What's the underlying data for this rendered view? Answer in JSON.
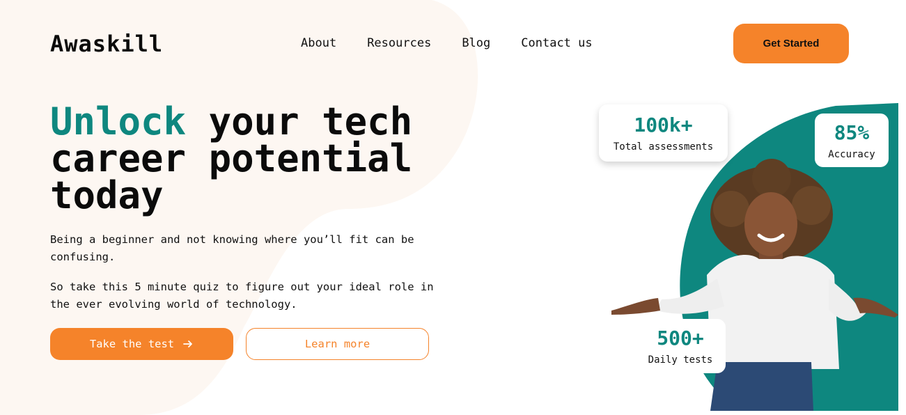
{
  "brand": {
    "name": "Awaskill"
  },
  "nav": {
    "items": [
      {
        "label": "About"
      },
      {
        "label": "Resources"
      },
      {
        "label": "Blog"
      },
      {
        "label": "Contact us"
      }
    ]
  },
  "header": {
    "cta_label": "Get Started"
  },
  "hero": {
    "headline_accent": "Unlock",
    "headline_rest": " your tech career potential today",
    "paragraph_1": "Being a beginner and not knowing where you’ll fit can be confusing.",
    "paragraph_2": "So take this 5 minute quiz to figure out your ideal role in the ever evolving world of technology.",
    "primary_label": "Take the test",
    "secondary_label": "Learn more"
  },
  "stats": [
    {
      "value": "100k+",
      "label": "Total assessments"
    },
    {
      "value": "85%",
      "label": "Accuracy"
    },
    {
      "value": "500+",
      "label": "Daily tests"
    }
  ],
  "colors": {
    "accent": "#0e877f",
    "brand_orange": "#f5832a",
    "blob": "#fdf7f2",
    "text": "#111111"
  },
  "icons": {
    "arrow": "arrow-right-icon"
  }
}
